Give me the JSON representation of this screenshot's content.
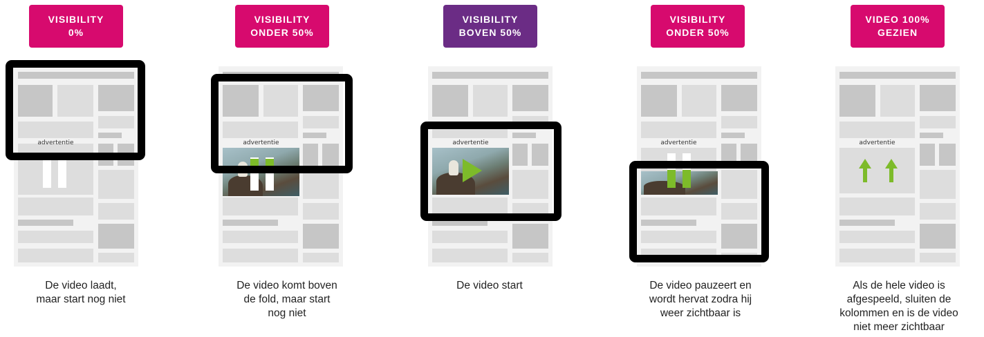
{
  "steps": [
    {
      "badge_line1": "VISIBILITY",
      "badge_line2": "0%",
      "badge_color": "#d70a6e",
      "caption_lines": [
        "De video laadt,",
        "maar start nog niet"
      ],
      "ad_label": "advertentie",
      "state": "paused"
    },
    {
      "badge_line1": "VISIBILITY",
      "badge_line2": "ONDER 50%",
      "badge_color": "#d70a6e",
      "caption_lines": [
        "De video komt boven",
        "de fold, maar start",
        "nog niet"
      ],
      "ad_label": "advertentie",
      "state": "paused"
    },
    {
      "badge_line1": "VISIBILITY",
      "badge_line2": "BOVEN 50%",
      "badge_color": "#6b2c85",
      "caption_lines": [
        "De video start"
      ],
      "ad_label": "advertentie",
      "state": "playing"
    },
    {
      "badge_line1": "VISIBILITY",
      "badge_line2": "ONDER 50%",
      "badge_color": "#d70a6e",
      "caption_lines": [
        "De video pauzeert en",
        "wordt hervat zodra hij",
        "weer zichtbaar is"
      ],
      "ad_label": "advertentie",
      "state": "paused"
    },
    {
      "badge_line1": "VIDEO 100%",
      "badge_line2": "GEZIEN",
      "badge_color": "#d70a6e",
      "caption_lines": [
        "Als de hele video is",
        "afgespeeld, sluiten de",
        "kolommen en is de video",
        "niet meer zichtbaar"
      ],
      "ad_label": "advertentie",
      "state": "closing"
    }
  ],
  "colors": {
    "accent_green": "#7dbb2a",
    "frame": "#000000",
    "page_bg": "#f2f2f2",
    "block_dark": "#c6c6c6",
    "block_light": "#dddddd"
  }
}
